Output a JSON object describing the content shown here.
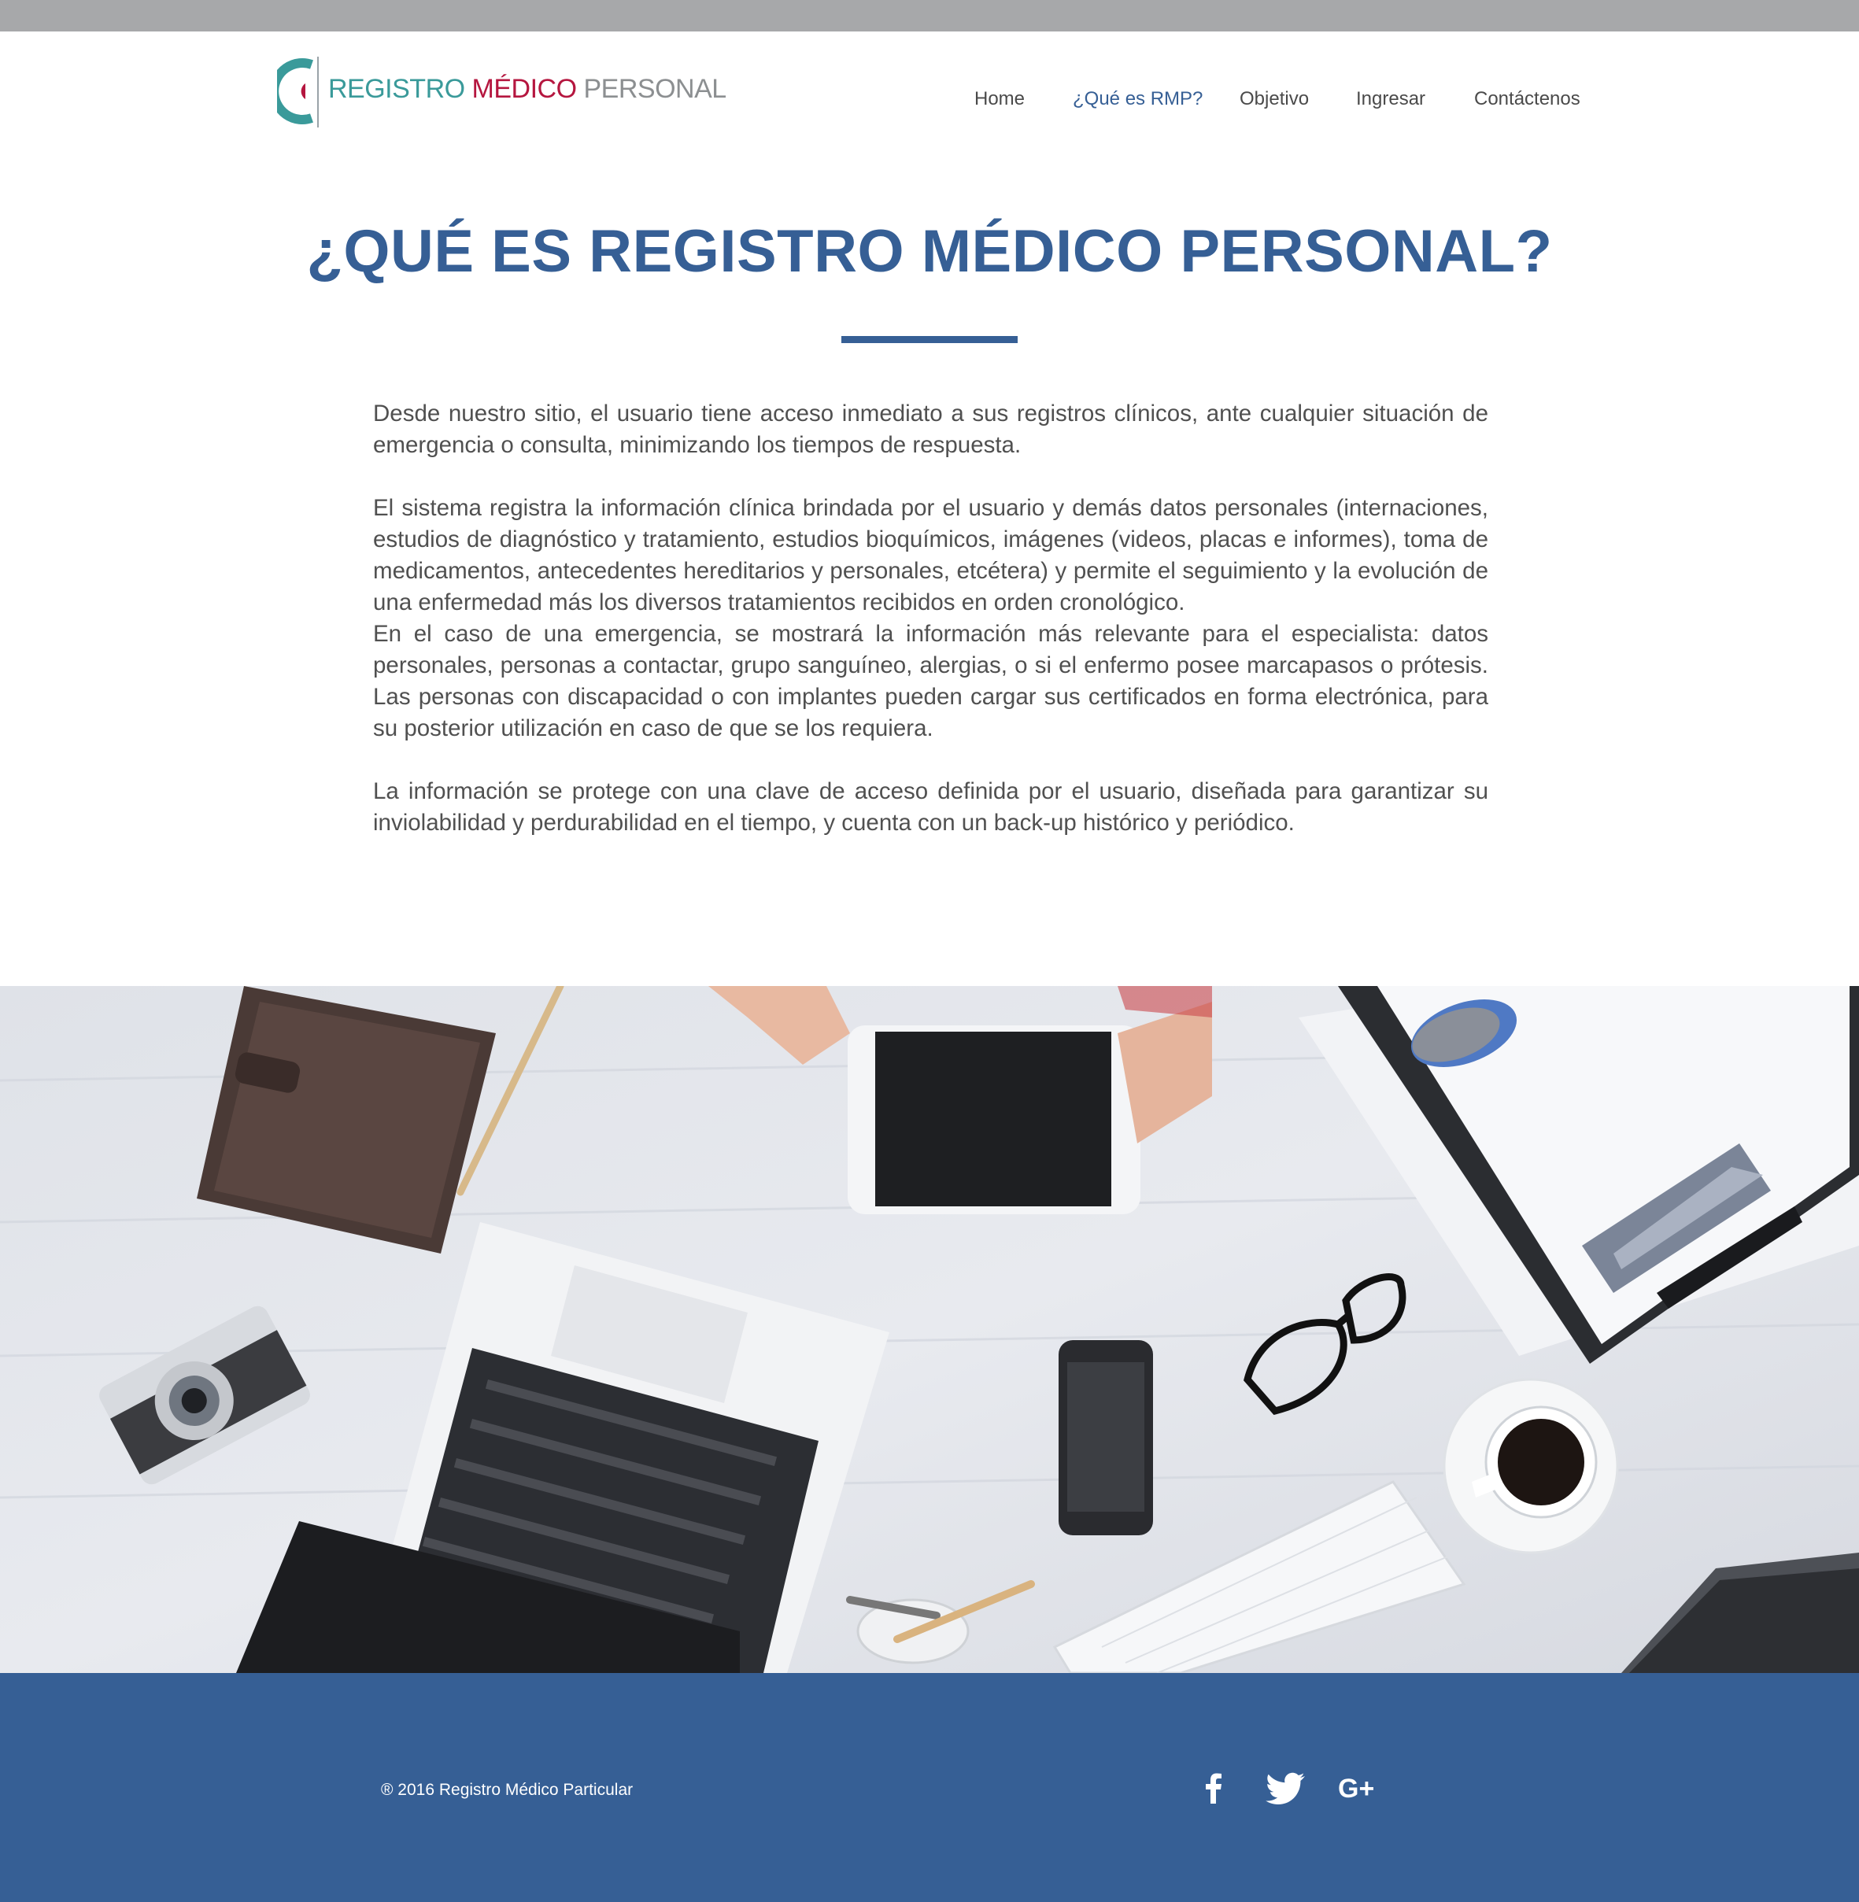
{
  "logo": {
    "word1": "REGISTRO",
    "word2": "MÉDICO",
    "word3": "PERSONAL"
  },
  "nav": {
    "items": [
      {
        "label": "Home",
        "active": false
      },
      {
        "label": "¿Qué es RMP?",
        "active": true
      },
      {
        "label": "Objetivo",
        "active": false
      },
      {
        "label": "Ingresar",
        "active": false
      },
      {
        "label": "Contáctenos",
        "active": false
      }
    ]
  },
  "main": {
    "title": "¿QUÉ ES REGISTRO MÉDICO PERSONAL?",
    "paragraphs": [
      "Desde nuestro sitio, el usuario tiene acceso inmediato a sus registros clínicos, ante cualquier situación de emergencia o consulta, minimizando los tiempos de respuesta.",
      "El sistema registra la información clínica brindada por el usuario y demás datos personales (internaciones, estudios de diagnóstico y tratamiento, estudios bioquímicos, imágenes (videos, placas e informes), toma de medicamentos,  antecedentes hereditarios y personales, etcétera) y permite el seguimiento y la evolución de una enfermedad más los diversos tratamientos recibidos en orden cronológico.",
      "En el caso de una emergencia, se mostrará la información más relevante para el especialista: datos personales, personas a contactar, grupo sanguíneo, alergias, o si el enfermo posee marcapasos o prótesis. Las personas con discapacidad o con implantes pueden cargar sus certificados en forma electrónica, para su posterior utilización en caso de que se los requiera.",
      "La información se protege con una clave de acceso definida por el usuario, diseñada para garantizar su inviolabilidad y perdurabilidad en el tiempo, y cuenta con un back-up histórico y periódico."
    ]
  },
  "photo": {
    "depicts": "workspace-desk-photo"
  },
  "footer": {
    "copyright": "® 2016 Registro Médico Particular",
    "social": [
      {
        "icon": "facebook-icon"
      },
      {
        "icon": "twitter-icon"
      },
      {
        "icon": "google-plus-icon",
        "text": "G+"
      }
    ]
  },
  "colors": {
    "accent": "#365f95",
    "topbar": "#a7a8aa",
    "body_text": "#505050",
    "logo_teal": "#3a9a9a",
    "logo_red": "#b5163f",
    "logo_grey": "#8c8f91"
  }
}
